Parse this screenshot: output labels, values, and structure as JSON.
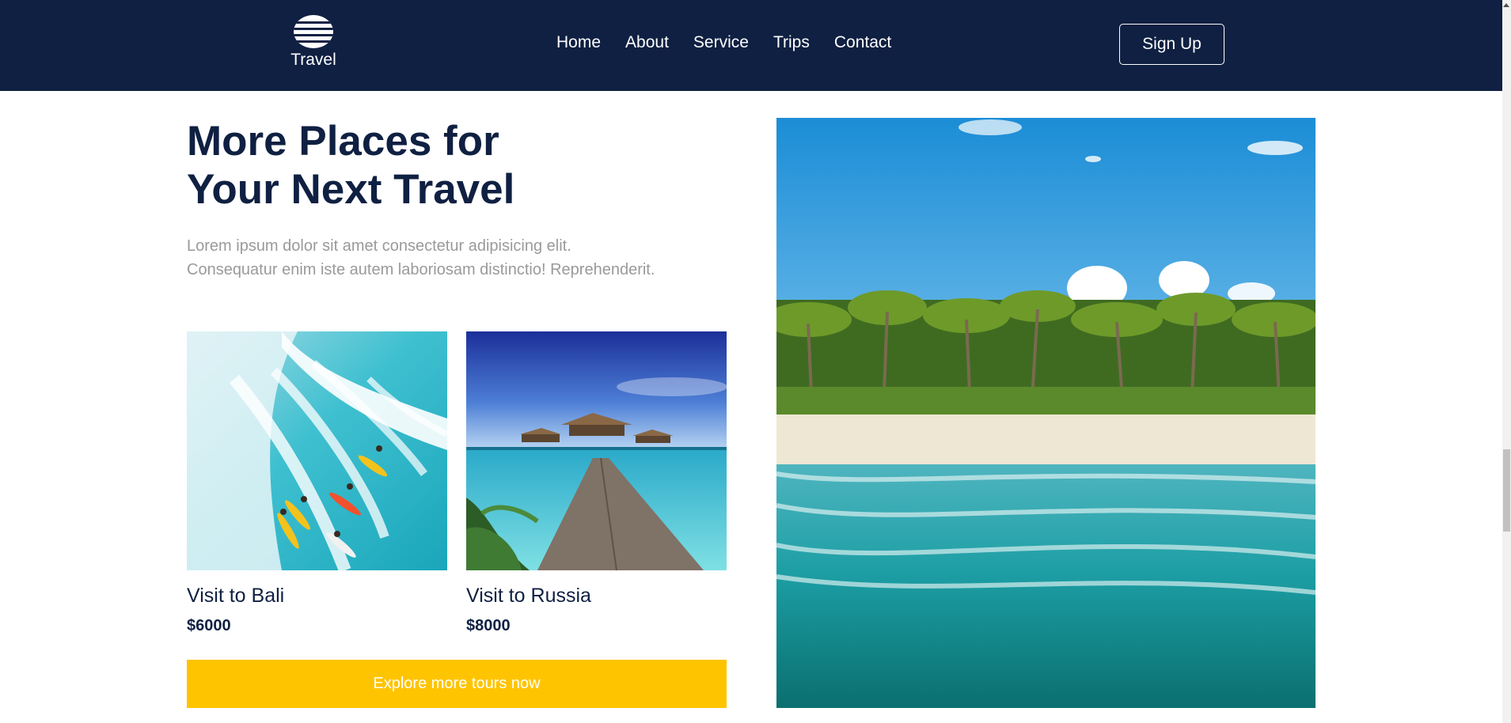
{
  "nav": {
    "logo_text": "Travel",
    "links": [
      "Home",
      "About",
      "Service",
      "Trips",
      "Contact"
    ],
    "signup_label": "Sign Up"
  },
  "main": {
    "heading_line1": "More Places for",
    "heading_line2": "Your Next Travel",
    "desc_line1": "Lorem ipsum dolor sit amet consectetur adipisicing elit.",
    "desc_line2": "Consequatur enim iste autem laboriosam distinctio! Reprehenderit.",
    "cards": [
      {
        "title": "Visit to Bali",
        "price": "$6000"
      },
      {
        "title": "Visit to Russia",
        "price": "$8000"
      }
    ],
    "cta_label": "Explore more tours now"
  },
  "colors": {
    "navbar_bg": "#0f2042",
    "accent_yellow": "#ffc400",
    "heading_text": "#0f2042",
    "muted_text": "#9a9a9a"
  }
}
